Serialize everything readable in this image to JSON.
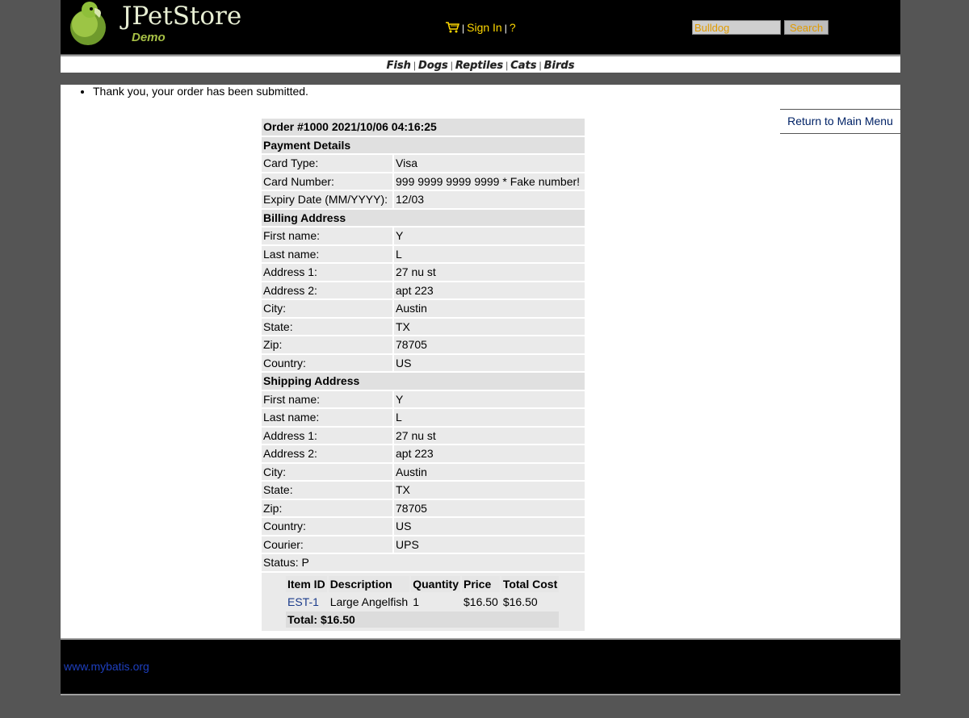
{
  "header": {
    "logo_title": "JPetStore",
    "logo_subtitle": "Demo",
    "menu": {
      "sign_in": "Sign In",
      "help": "?"
    },
    "search": {
      "value": "Bulldog",
      "button": "Search"
    }
  },
  "quicklinks": [
    "Fish",
    "Dogs",
    "Reptiles",
    "Cats",
    "Birds"
  ],
  "messages": [
    "Thank you, your order has been submitted."
  ],
  "back_link": "Return to Main Menu",
  "order": {
    "title": "Order #1000 2021/10/06 04:16:25",
    "payment_header": "Payment Details",
    "payment": [
      {
        "label": "Card Type:",
        "value": "Visa"
      },
      {
        "label": "Card Number:",
        "value": "999 9999 9999 9999 * Fake number!"
      },
      {
        "label": "Expiry Date (MM/YYYY):",
        "value": "12/03"
      }
    ],
    "billing_header": "Billing Address",
    "billing": [
      {
        "label": "First name:",
        "value": "Y"
      },
      {
        "label": "Last name:",
        "value": "L"
      },
      {
        "label": "Address 1:",
        "value": "27 nu st"
      },
      {
        "label": "Address 2:",
        "value": "apt 223"
      },
      {
        "label": "City:",
        "value": "Austin"
      },
      {
        "label": "State:",
        "value": "TX"
      },
      {
        "label": "Zip:",
        "value": "78705"
      },
      {
        "label": "Country:",
        "value": "US"
      }
    ],
    "shipping_header": "Shipping Address",
    "shipping": [
      {
        "label": "First name:",
        "value": "Y"
      },
      {
        "label": "Last name:",
        "value": "L"
      },
      {
        "label": "Address 1:",
        "value": "27 nu st"
      },
      {
        "label": "Address 2:",
        "value": "apt 223"
      },
      {
        "label": "City:",
        "value": "Austin"
      },
      {
        "label": "State:",
        "value": "TX"
      },
      {
        "label": "Zip:",
        "value": "78705"
      },
      {
        "label": "Country:",
        "value": "US"
      },
      {
        "label": "Courier:",
        "value": "UPS"
      }
    ],
    "status": "Status: P",
    "items": {
      "columns": [
        "Item ID",
        "Description",
        "Quantity",
        "Price",
        "Total Cost"
      ],
      "rows": [
        {
          "item_id": "EST-1",
          "description": "Large Angelfish",
          "quantity": "1",
          "price": "$16.50",
          "total": "$16.50"
        }
      ],
      "total": "Total: $16.50"
    }
  },
  "footer": {
    "link": "www.mybatis.org"
  },
  "colors": {
    "header_bg": "#000000",
    "page_bg": "#555555",
    "link_yellow": "#ffd800",
    "row_bg": "#eaeaea"
  }
}
